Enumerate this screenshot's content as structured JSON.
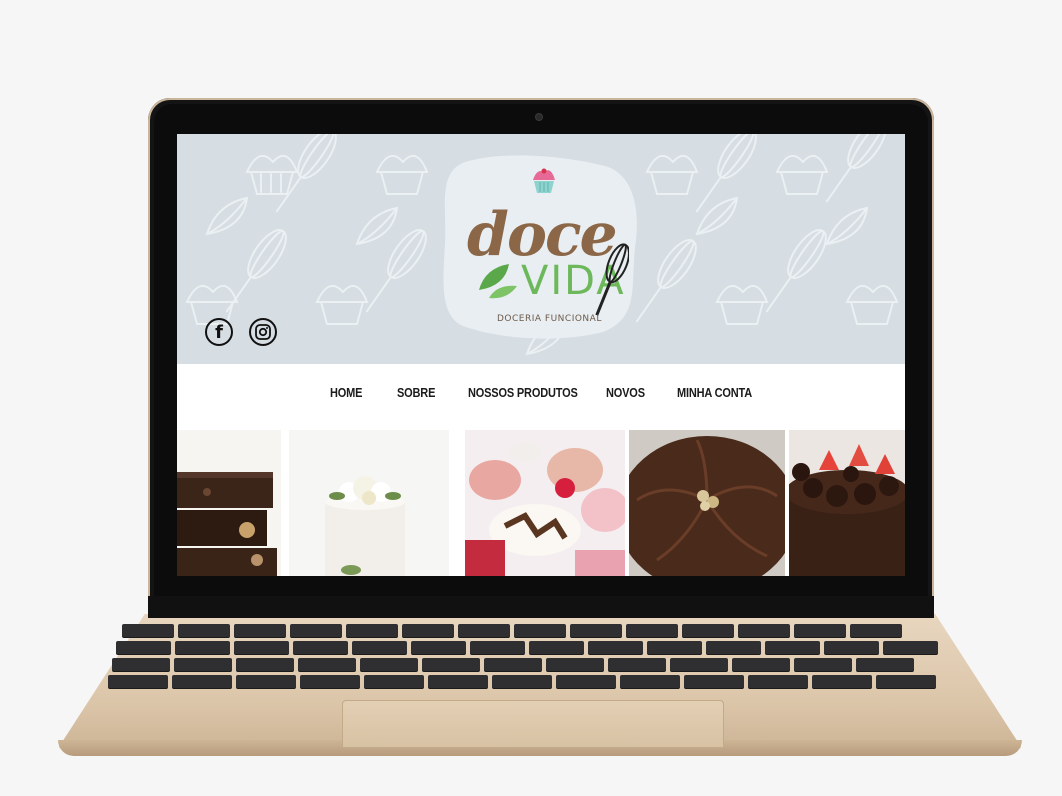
{
  "site": {
    "logo": {
      "word1": "doce",
      "word2": "VIDA",
      "tagline": "DOCERIA FUNCIONAL"
    },
    "social": {
      "facebook_glyph": "f",
      "facebook_icon": "facebook-icon",
      "instagram_icon": "instagram-icon"
    },
    "nav": {
      "items": [
        {
          "label": "HOME"
        },
        {
          "label": "SOBRE"
        },
        {
          "label": "NOSSOS PRODUTOS"
        },
        {
          "label": "NOVOS"
        },
        {
          "label": "MINHA CONTA"
        }
      ]
    },
    "gallery": {
      "photos": [
        {
          "name": "brownie-photo"
        },
        {
          "name": "floral-cake-photo"
        },
        {
          "name": "cupcakes-photo"
        },
        {
          "name": "chocolate-tart-photo"
        },
        {
          "name": "strawberry-truffle-cake-photo"
        }
      ]
    }
  },
  "colors": {
    "hero_bg": "#d6dde3",
    "logo_brown": "#8b6748",
    "logo_green": "#6cb85a",
    "nav_text": "#1b1b1b",
    "laptop_gold": "#dcc6aa"
  }
}
